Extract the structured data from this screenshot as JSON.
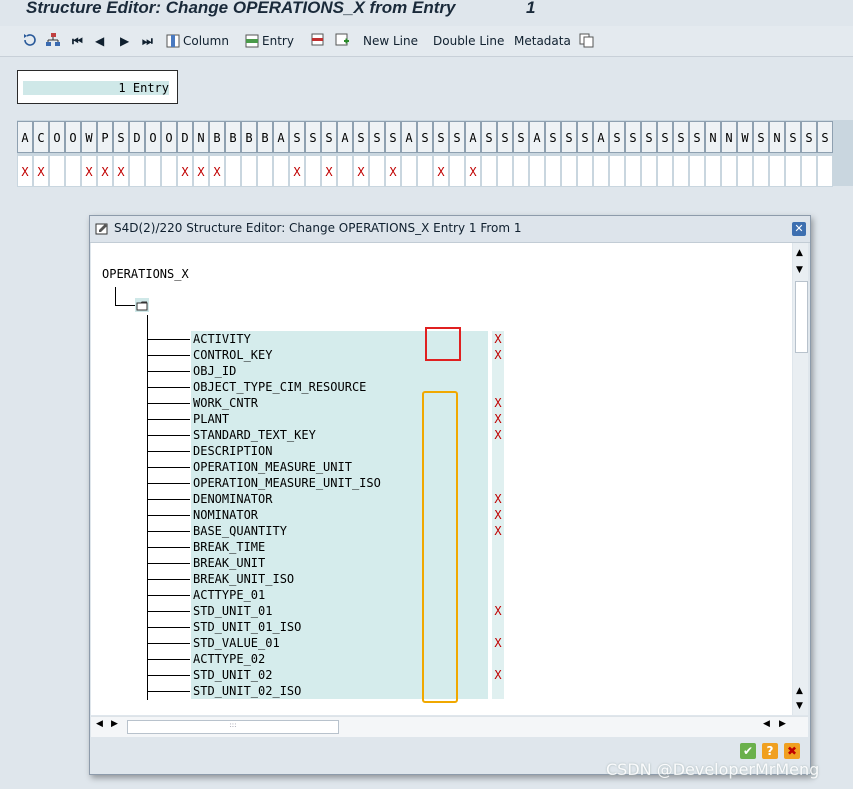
{
  "window": {
    "title": "Structure Editor: Change OPERATIONS_X from Entry",
    "entry_number": "1"
  },
  "toolbar": {
    "column_label": "Column",
    "entry_label": "Entry",
    "new_line_label": "New Line",
    "double_line_label": "Double Line",
    "metadata_label": "Metadata"
  },
  "entry_count": "1 Entry",
  "grid": {
    "headers": [
      "A",
      "C",
      "O",
      "O",
      "W",
      "P",
      "S",
      "D",
      "O",
      "O",
      "D",
      "N",
      "B",
      "B",
      "B",
      "B",
      "A",
      "S",
      "S",
      "S",
      "A",
      "S",
      "S",
      "S",
      "A",
      "S",
      "S",
      "S",
      "A",
      "S",
      "S",
      "S",
      "A",
      "S",
      "S",
      "S",
      "A",
      "S",
      "S",
      "S",
      "S",
      "S",
      "S",
      "N",
      "N",
      "W",
      "S",
      "N",
      "S",
      "S",
      "S"
    ],
    "values": [
      "X",
      "X",
      "",
      "",
      "X",
      "X",
      "X",
      "",
      "",
      "",
      "X",
      "X",
      "X",
      "",
      "",
      "",
      "",
      "X",
      "",
      "X",
      "",
      "X",
      "",
      "X",
      "",
      "",
      "X",
      "",
      "X",
      "",
      "",
      "",
      "",
      "",
      "",
      "",
      "",
      "",
      "",
      "",
      "",
      "",
      "",
      "",
      "",
      "",
      "",
      "",
      "",
      "",
      ""
    ]
  },
  "dialog": {
    "title": "S4D(2)/220 Structure Editor: Change OPERATIONS_X Entry 1 From 1",
    "root_label": "OPERATIONS_X",
    "fields": [
      {
        "name": "ACTIVITY",
        "value": "X"
      },
      {
        "name": "CONTROL_KEY",
        "value": "X"
      },
      {
        "name": "OBJ_ID",
        "value": ""
      },
      {
        "name": "OBJECT_TYPE_CIM_RESOURCE",
        "value": ""
      },
      {
        "name": "WORK_CNTR",
        "value": "X"
      },
      {
        "name": "PLANT",
        "value": "X"
      },
      {
        "name": "STANDARD_TEXT_KEY",
        "value": "X"
      },
      {
        "name": "DESCRIPTION",
        "value": ""
      },
      {
        "name": "OPERATION_MEASURE_UNIT",
        "value": ""
      },
      {
        "name": "OPERATION_MEASURE_UNIT_ISO",
        "value": ""
      },
      {
        "name": "DENOMINATOR",
        "value": "X"
      },
      {
        "name": "NOMINATOR",
        "value": "X"
      },
      {
        "name": "BASE_QUANTITY",
        "value": "X"
      },
      {
        "name": "BREAK_TIME",
        "value": ""
      },
      {
        "name": "BREAK_UNIT",
        "value": ""
      },
      {
        "name": "BREAK_UNIT_ISO",
        "value": ""
      },
      {
        "name": "ACTTYPE_01",
        "value": ""
      },
      {
        "name": "STD_UNIT_01",
        "value": "X"
      },
      {
        "name": "STD_UNIT_01_ISO",
        "value": ""
      },
      {
        "name": "STD_VALUE_01",
        "value": "X"
      },
      {
        "name": "ACTTYPE_02",
        "value": ""
      },
      {
        "name": "STD_UNIT_02",
        "value": "X"
      },
      {
        "name": "STD_UNIT_02_ISO",
        "value": ""
      }
    ],
    "close_symbol": "✕",
    "scroll_grip": ":::",
    "confirm_symbol": "✔",
    "help_symbol": "?",
    "cancel_symbol": "✖"
  },
  "watermark": "CSDN @DeveloperMrMeng",
  "colors": {
    "highlight_red": "#e02020",
    "highlight_orange": "#f0a800"
  }
}
